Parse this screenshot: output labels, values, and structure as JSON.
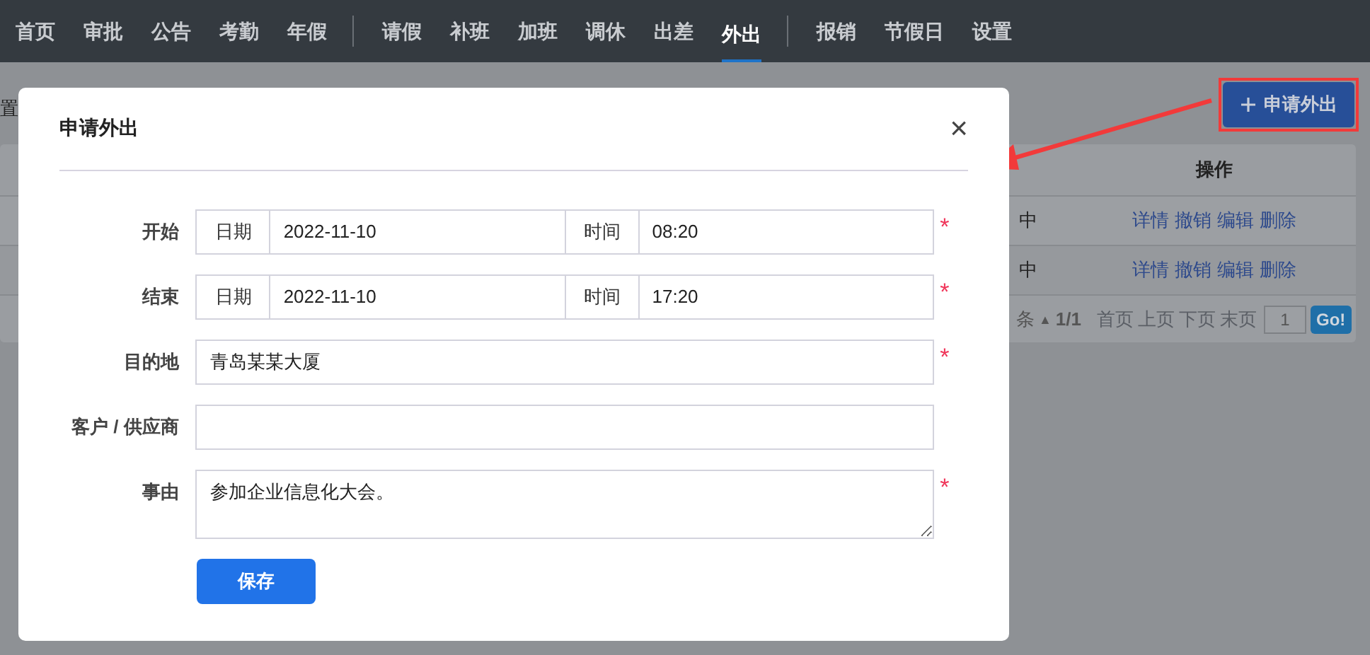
{
  "nav": {
    "groups": [
      [
        {
          "label": "首页",
          "selected": false
        },
        {
          "label": "审批",
          "selected": false
        },
        {
          "label": "公告",
          "selected": false
        },
        {
          "label": "考勤",
          "selected": false
        },
        {
          "label": "年假",
          "selected": false
        }
      ],
      [
        {
          "label": "请假",
          "selected": false
        },
        {
          "label": "补班",
          "selected": false
        },
        {
          "label": "加班",
          "selected": false
        },
        {
          "label": "调休",
          "selected": false
        },
        {
          "label": "出差",
          "selected": false
        },
        {
          "label": "外出",
          "selected": true
        }
      ],
      [
        {
          "label": "报销",
          "selected": false
        },
        {
          "label": "节假日",
          "selected": false
        },
        {
          "label": "设置",
          "selected": false
        }
      ]
    ]
  },
  "page": {
    "breadcrumb_fragment": "置",
    "new_button": "申请外出",
    "table": {
      "header": "操作",
      "rows": [
        {
          "status_fragment": "中",
          "actions": [
            "详情",
            "撤销",
            "编辑",
            "删除"
          ]
        },
        {
          "status_fragment": "中",
          "actions": [
            "详情",
            "撤销",
            "编辑",
            "删除"
          ]
        }
      ],
      "pager": {
        "count_fragment": "条",
        "sort_mark": "▲",
        "pages": "1/1",
        "links": [
          "首页",
          "上页",
          "下页",
          "末页"
        ],
        "page_input": "1",
        "go": "Go!"
      }
    }
  },
  "dialog": {
    "title": "申请外出",
    "close": "×",
    "required_mark": "*",
    "fields": [
      {
        "kind": "datetime",
        "label": "开始",
        "date_label": "日期",
        "date": "2022-11-10",
        "time_label": "时间",
        "time": "08:20",
        "required": true
      },
      {
        "kind": "datetime",
        "label": "结束",
        "date_label": "日期",
        "date": "2022-11-10",
        "time_label": "时间",
        "time": "17:20",
        "required": true
      },
      {
        "kind": "text",
        "label": "目的地",
        "value": "青岛某某大厦",
        "required": true
      },
      {
        "kind": "text",
        "label": "客户 / 供应商",
        "required": false
      },
      {
        "kind": "textarea",
        "label": "事由",
        "value": "参加企业信息化大会。",
        "required": true
      }
    ],
    "save": "保存"
  }
}
